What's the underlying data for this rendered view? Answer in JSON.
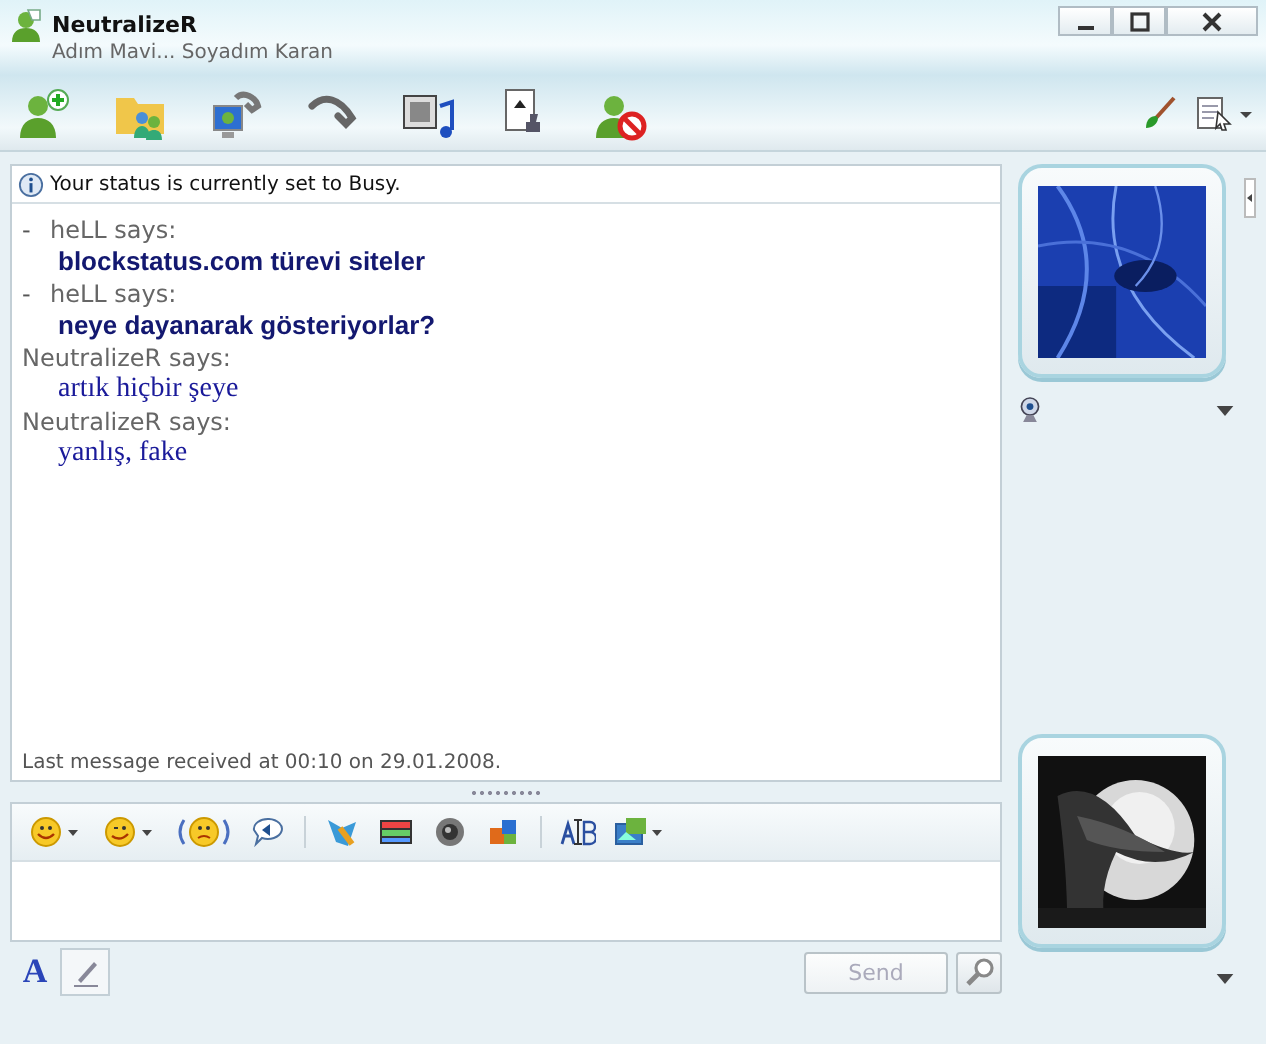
{
  "window": {
    "title": "NeutralizeR",
    "subtitle": "Adım Mavi... Soyadım Karan"
  },
  "info_bar": {
    "text": "Your status is currently set to Busy."
  },
  "messages": [
    {
      "kind": "contact",
      "prefix": "-",
      "sender": "heLL says:",
      "text": "blockstatus.com türevi siteler"
    },
    {
      "kind": "contact",
      "prefix": "-",
      "sender": "heLL says:",
      "text": "neye dayanarak gösteriyorlar?"
    },
    {
      "kind": "self",
      "sender": "NeutralizeR says:",
      "text": "artık hiçbir şeye"
    },
    {
      "kind": "self",
      "sender": "NeutralizeR says:",
      "text": "yanlış, fake"
    }
  ],
  "last_message": "Last message received at 00:10 on 29.01.2008.",
  "format_buttons": [
    {
      "kind": "font",
      "label": "A",
      "selected": false
    },
    {
      "kind": "pen",
      "selected": true
    }
  ],
  "send_button": {
    "label": "Send",
    "disabled": true
  }
}
